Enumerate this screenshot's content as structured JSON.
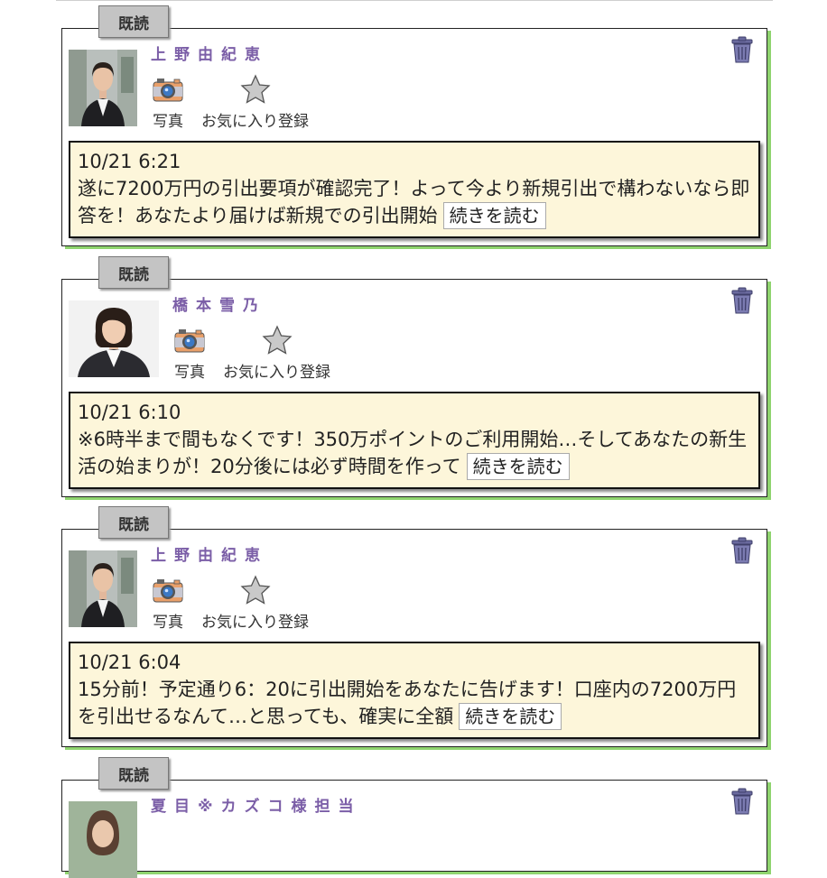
{
  "read_label": "既読",
  "photo_label": "写真",
  "favorite_label": "お気に入り登録",
  "read_more_label": "続きを読む",
  "messages": [
    {
      "name": "上野由紀恵",
      "time": "10/21 6:21",
      "text": "遂に7200万円の引出要項が確認完了！よって今より新規引出で構わないなら即答を！あなたより届けば新規での引出開始"
    },
    {
      "name": "橋本雪乃",
      "time": "10/21 6:10",
      "text": "※6時半まで間もなくです！350万ポイントのご利用開始…そしてあなたの新生活の始まりが！20分後には必ず時間を作って"
    },
    {
      "name": "上野由紀恵",
      "time": "10/21 6:04",
      "text": "15分前！予定通り6：20に引出開始をあなたに告げます！口座内の7200万円を引出せるなんて…と思っても、確実に全額"
    },
    {
      "name": "夏目※カズコ様担当"
    }
  ]
}
